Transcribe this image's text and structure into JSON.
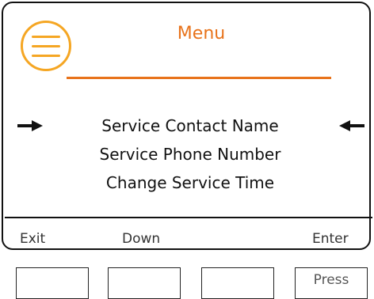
{
  "header": {
    "title": "Menu",
    "menu_icon": "hamburger-menu-icon",
    "accent_color": "#e8731b",
    "icon_color": "#f5a623"
  },
  "menu": {
    "items": [
      {
        "label": "Service Contact Name",
        "selected": true
      },
      {
        "label": "Service Phone Number",
        "selected": false
      },
      {
        "label": "Change Service Time",
        "selected": false
      }
    ],
    "selection_icons": [
      "arrow-right-icon",
      "arrow-left-icon"
    ]
  },
  "softkeys": {
    "exit_label": "Exit",
    "down_label": "Down",
    "enter_label": "Enter"
  },
  "hardware_buttons": {
    "fourth_label": "Press"
  }
}
